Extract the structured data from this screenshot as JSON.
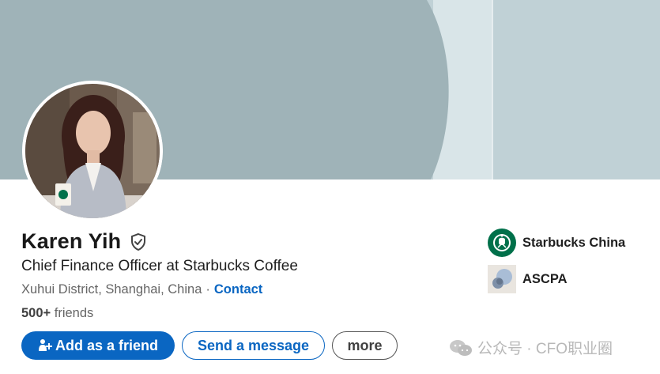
{
  "profile": {
    "name": "Karen Yih",
    "headline": "Chief Finance Officer at Starbucks Coffee",
    "location": "Xuhui District, Shanghai, China",
    "separator": "·",
    "contact_label": "Contact",
    "friends_count": "500+",
    "friends_label": "friends"
  },
  "actions": {
    "add_friend": "Add as a friend",
    "send_message": "Send a message",
    "more": "more"
  },
  "organizations": [
    {
      "name": "Starbucks China",
      "logo": "starbucks-logo"
    },
    {
      "name": "ASCPA",
      "logo": "ascpa-logo"
    }
  ],
  "watermark": {
    "text": "公众号 · CFO职业圈",
    "icon": "wechat-icon"
  },
  "colors": {
    "accent": "#0a66c2",
    "cover_dark": "#9fb3b8",
    "cover_light": "#c0d1d6",
    "starbucks_green": "#00704a"
  }
}
